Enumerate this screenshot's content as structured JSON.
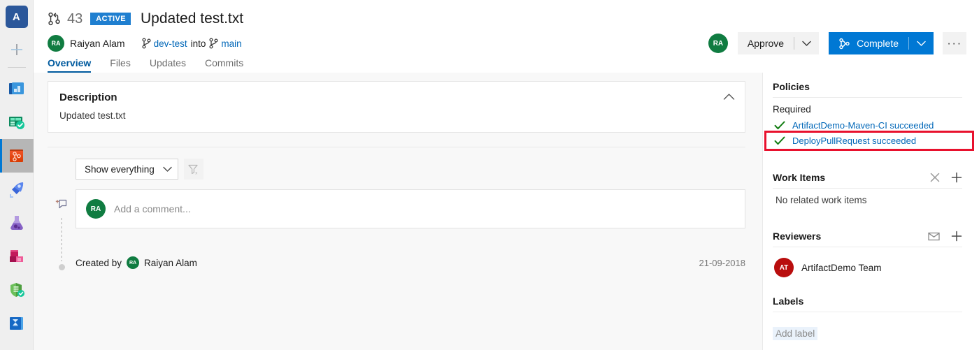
{
  "colors": {
    "accent": "#0078d4",
    "link": "#0067b8",
    "active_badge": "#1f7fd0",
    "success_green": "#107c10",
    "highlight_red": "#e8112d",
    "avatar_green": "#107c41",
    "avatar_red": "#b90e0e",
    "org_avatar_blue": "#2b579a"
  },
  "rail": {
    "org_initial": "A",
    "add_label": "+",
    "items": [
      {
        "name": "boards-icon",
        "title": "Boards"
      },
      {
        "name": "test-plans-overview-icon",
        "title": "Boards"
      },
      {
        "name": "repos-icon",
        "title": "Repos",
        "selected": true
      },
      {
        "name": "pipelines-icon",
        "title": "Pipelines"
      },
      {
        "name": "test-plans-icon",
        "title": "Test Plans"
      },
      {
        "name": "artifacts-icon",
        "title": "Artifacts"
      },
      {
        "name": "security-icon",
        "title": "Advanced Security"
      },
      {
        "name": "analytics-icon",
        "title": "Analytics"
      }
    ]
  },
  "pr": {
    "number": "43",
    "status": "ACTIVE",
    "title": "Updated test.txt",
    "author": "Raiyan Alam",
    "author_initials": "RA",
    "source_branch": "dev-test",
    "into_word": "into",
    "target_branch": "main",
    "tabs": [
      {
        "label": "Overview",
        "active": true
      },
      {
        "label": "Files",
        "active": false
      },
      {
        "label": "Updates",
        "active": false
      },
      {
        "label": "Commits",
        "active": false
      }
    ],
    "actions": {
      "reviewer_initials": "RA",
      "approve_label": "Approve",
      "complete_label": "Complete",
      "ellipsis_label": "···"
    }
  },
  "description": {
    "heading": "Description",
    "text": "Updated test.txt"
  },
  "discussion": {
    "filter_value": "Show everything",
    "clear_filter_name": "clear-filter",
    "comment_placeholder": "Add a comment...",
    "comment_avatar_initials": "RA",
    "created_by_label": "Created by",
    "created_by_name": "Raiyan Alam",
    "created_by_initials": "RA",
    "created_date": "21-09-2018"
  },
  "policies": {
    "heading": "Policies",
    "required_label": "Required",
    "items": [
      {
        "text": "ArtifactDemo-Maven-CI succeeded",
        "state": "succeeded",
        "highlighted": false
      },
      {
        "text": "DeployPullRequest succeeded",
        "state": "succeeded",
        "highlighted": true
      }
    ]
  },
  "work_items": {
    "heading": "Work Items",
    "empty_text": "No related work items",
    "remove_icon": "close-icon",
    "add_icon": "plus-icon"
  },
  "reviewers": {
    "heading": "Reviewers",
    "mail_icon": "mail-icon",
    "add_icon": "plus-icon",
    "list": [
      {
        "name": "ArtifactDemo Team",
        "initials": "AT",
        "color": "red"
      }
    ]
  },
  "labels": {
    "heading": "Labels",
    "add_label": "Add label"
  }
}
